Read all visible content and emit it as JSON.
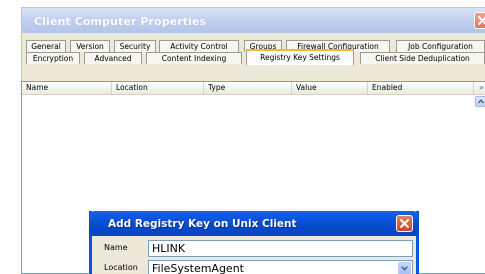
{
  "main_window": {
    "title": "Client Computer Properties",
    "tabs_row1": [
      "General",
      "Version",
      "Security",
      "Activity Control",
      "Groups",
      "Firewall Configuration",
      "Job Configuration"
    ],
    "tabs_row2": [
      "Encryption",
      "Advanced",
      "Content Indexing",
      "Registry Key Settings",
      "Client Side Deduplication"
    ],
    "active_tab": "Registry Key Settings",
    "active_tab_accent": "#f4b63f"
  },
  "list": {
    "columns": [
      "Name",
      "Location",
      "Type",
      "Value",
      "Enabled"
    ],
    "rows": []
  },
  "sub_dialog": {
    "title": "Add Registry Key on Unix Client",
    "name_label": "Name",
    "name_value": "HLINK",
    "location_label": "Location",
    "location_value": "FileSystemAgent",
    "titlebar_color": "#0a55dd"
  }
}
